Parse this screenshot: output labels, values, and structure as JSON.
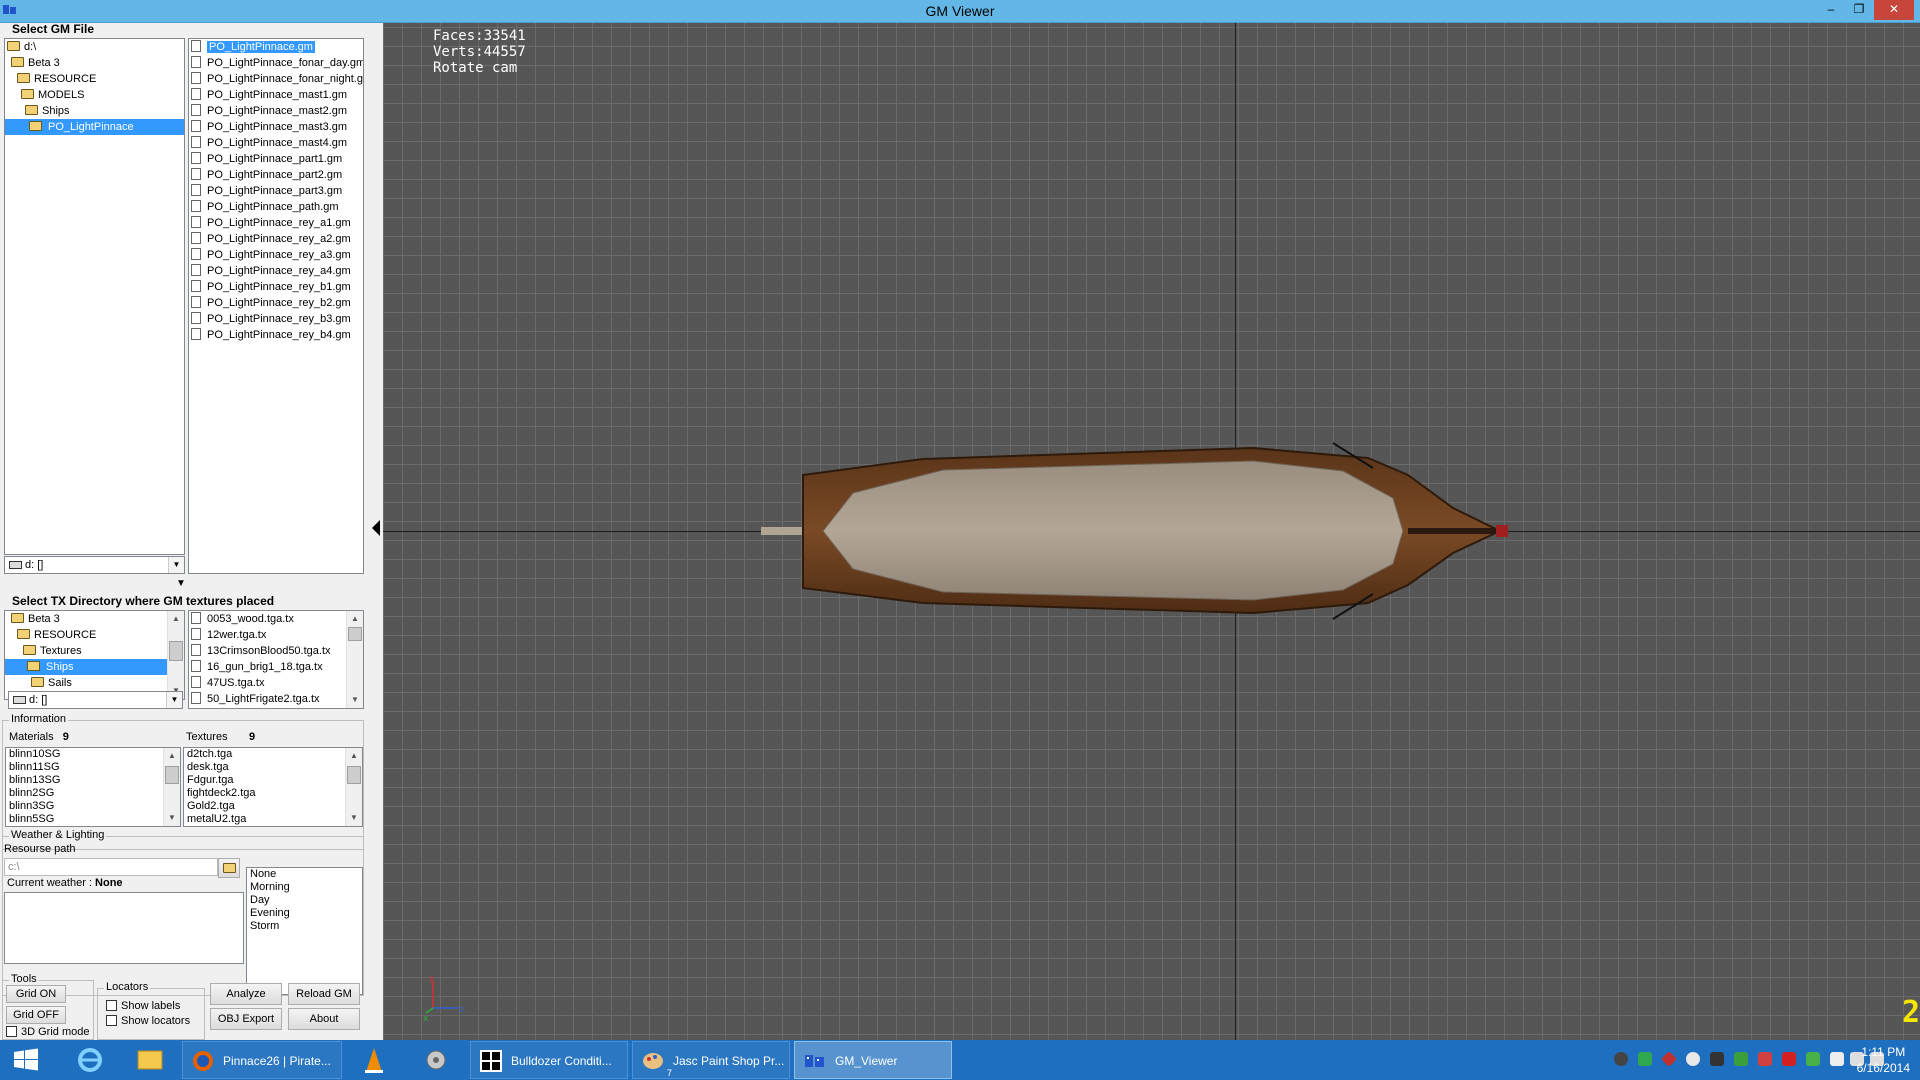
{
  "window": {
    "title": "GM Viewer",
    "buttons": {
      "minimize": "–",
      "maximize": "❐",
      "close": "✕"
    }
  },
  "gm_section": {
    "label": "Select GM File",
    "tree": [
      {
        "label": "d:\\",
        "selected": false
      },
      {
        "label": "Beta 3",
        "selected": false
      },
      {
        "label": "RESOURCE",
        "selected": false
      },
      {
        "label": "MODELS",
        "selected": false
      },
      {
        "label": "Ships",
        "selected": false
      },
      {
        "label": "PO_LightPinnace",
        "selected": true
      }
    ],
    "drive": "d: []",
    "files": [
      "PO_LightPinnace.gm",
      "PO_LightPinnace_fonar_day.gm",
      "PO_LightPinnace_fonar_night.gm",
      "PO_LightPinnace_mast1.gm",
      "PO_LightPinnace_mast2.gm",
      "PO_LightPinnace_mast3.gm",
      "PO_LightPinnace_mast4.gm",
      "PO_LightPinnace_part1.gm",
      "PO_LightPinnace_part2.gm",
      "PO_LightPinnace_part3.gm",
      "PO_LightPinnace_path.gm",
      "PO_LightPinnace_rey_a1.gm",
      "PO_LightPinnace_rey_a2.gm",
      "PO_LightPinnace_rey_a3.gm",
      "PO_LightPinnace_rey_a4.gm",
      "PO_LightPinnace_rey_b1.gm",
      "PO_LightPinnace_rey_b2.gm",
      "PO_LightPinnace_rey_b3.gm",
      "PO_LightPinnace_rey_b4.gm"
    ]
  },
  "tx_section": {
    "label": "Select TX Directory where GM textures placed",
    "tree": [
      {
        "label": "Beta 3",
        "selected": false
      },
      {
        "label": "RESOURCE",
        "selected": false
      },
      {
        "label": "Textures",
        "selected": false
      },
      {
        "label": "Ships",
        "selected": true
      },
      {
        "label": "Sails",
        "selected": false
      }
    ],
    "drive": "d: []",
    "files": [
      "0053_wood.tga.tx",
      "12wer.tga.tx",
      "13CrimsonBlood50.tga.tx",
      "16_gun_brig1_18.tga.tx",
      "47US.tga.tx",
      "50_LightFrigate2.tga.tx"
    ]
  },
  "information": {
    "title": "Information",
    "materials_label": "Materials",
    "materials_count": "9",
    "textures_label": "Textures",
    "textures_count": "9",
    "materials": [
      "blinn10SG",
      "blinn11SG",
      "blinn13SG",
      "blinn2SG",
      "blinn3SG",
      "blinn5SG"
    ],
    "textures": [
      "d2tch.tga",
      "desk.tga",
      "Fdgur.tga",
      "fightdeck2.tga",
      "Gold2.tga",
      "metalU2.tga"
    ]
  },
  "weather": {
    "title": "Weather & Lighting",
    "resource_path_label": "Resourse path",
    "resource_path_value": "c:\\",
    "current_weather_label": "Current weather :",
    "current_weather_value": "None",
    "options": [
      "None",
      "Morning",
      "Day",
      "Evening",
      "Storm"
    ]
  },
  "tools": {
    "title": "Tools",
    "grid_on": "Grid ON",
    "grid_off": "Grid OFF",
    "grid_3d": "3D Grid mode",
    "locators_title": "Locators",
    "show_labels": "Show labels",
    "show_locators": "Show locators",
    "analyze": "Analyze",
    "reload": "Reload GM",
    "obj_export": "OBJ Export",
    "about": "About"
  },
  "viewport": {
    "faces": "Faces:33541",
    "verts": "Verts:44557",
    "mode": "Rotate cam",
    "corner_number": "2",
    "gizmo_labels": {
      "x": "x",
      "y": "y",
      "z": "z"
    }
  },
  "taskbar": {
    "items": [
      {
        "label": "Pinnace26 | Pirate...",
        "badge": ""
      },
      {
        "label": "Bulldozer Conditi...",
        "badge": ""
      },
      {
        "label": "Jasc Paint Shop Pr...",
        "badge": "7"
      },
      {
        "label": "GM_Viewer",
        "badge": ""
      }
    ],
    "time": "1:11 PM",
    "date": "6/16/2014"
  },
  "colors": {
    "viewport_bg": "#565656",
    "grid": "#6b6b6b",
    "taskbar": "#1e6fbf",
    "titlebar": "#63b7e6",
    "selection": "#3399ff"
  }
}
